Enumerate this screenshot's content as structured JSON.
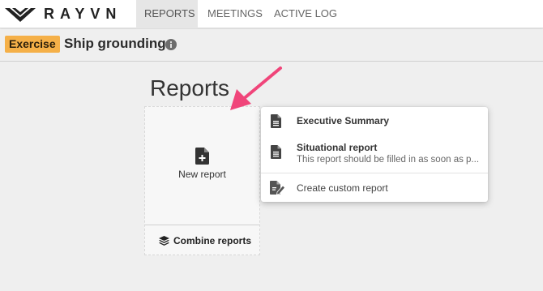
{
  "brand": {
    "name": "RAYVN"
  },
  "nav": {
    "tabs": [
      {
        "label": "REPORTS",
        "active": true
      },
      {
        "label": "MEETINGS",
        "active": false
      },
      {
        "label": "ACTIVE LOG",
        "active": false
      }
    ]
  },
  "incident": {
    "badge": "Exercise",
    "title": "Ship grounding",
    "info_icon": "info-icon"
  },
  "page": {
    "title": "Reports"
  },
  "new_report_card": {
    "icon": "file-plus-icon",
    "label": "New report",
    "combine_icon": "layers-icon",
    "combine_label": "Combine reports"
  },
  "report_menu": {
    "items": [
      {
        "icon": "document-icon",
        "title": "Executive Summary",
        "description": ""
      },
      {
        "icon": "document-icon",
        "title": "Situational report",
        "description": "This report should be filled in as soon as p..."
      },
      {
        "icon": "edit-document-icon",
        "title": "Create custom report",
        "description": ""
      }
    ]
  },
  "colors": {
    "badge": "#f5b048",
    "arrow": "#f0457a",
    "background": "#efefef",
    "active_tab": "#e6e6e6"
  }
}
